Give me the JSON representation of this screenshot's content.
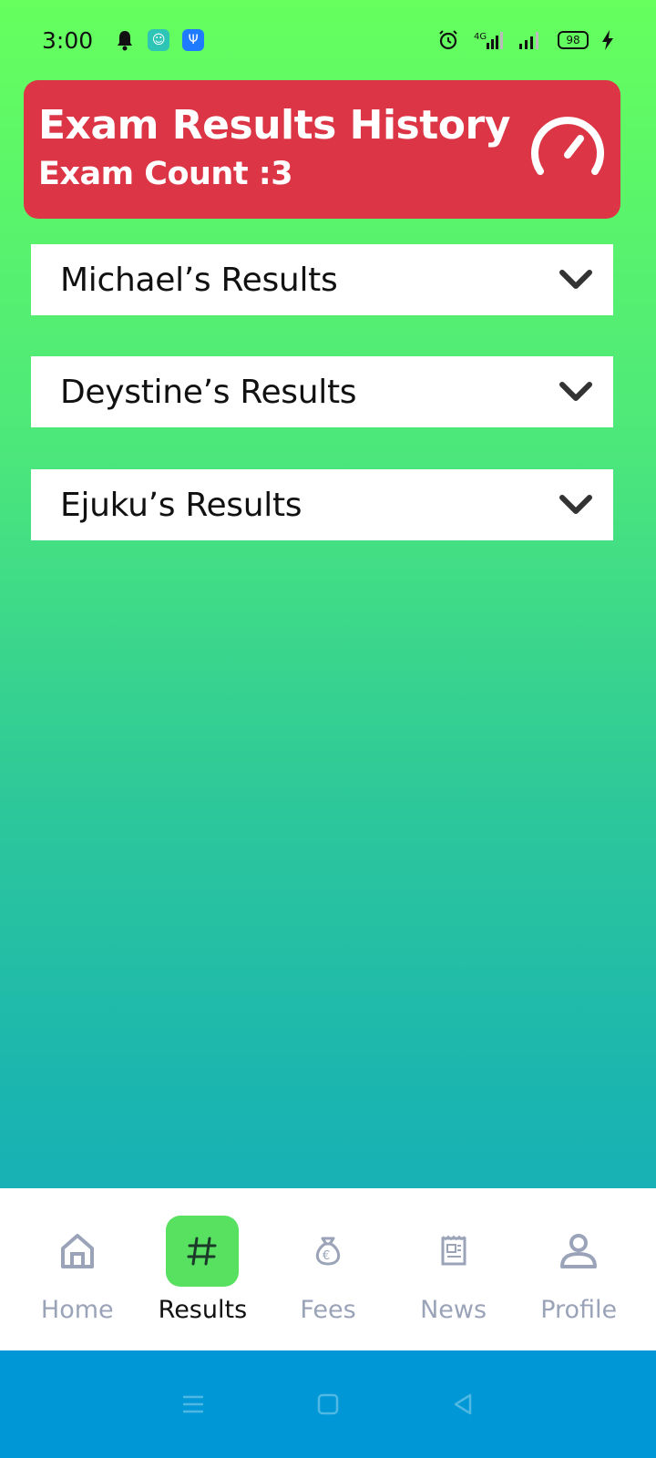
{
  "status_bar": {
    "time": "3:00",
    "battery": "98",
    "network": "4G",
    "icons": [
      "bell-icon",
      "app-chip-icon",
      "usb-icon",
      "alarm-icon",
      "signal-icon",
      "signal-icon",
      "battery-icon",
      "charging-icon"
    ]
  },
  "header": {
    "title": "Exam Results History",
    "count_label": "Exam Count :3",
    "icon": "speedometer-icon",
    "color": "#dc3545"
  },
  "results": {
    "items": [
      {
        "label": "Michael’s Results",
        "icon": "chevron-down-icon"
      },
      {
        "label": "Deystine’s Results",
        "icon": "chevron-down-icon"
      },
      {
        "label": "Ejuku’s Results",
        "icon": "chevron-down-icon"
      }
    ]
  },
  "bottom_nav": {
    "items": [
      {
        "label": "Home",
        "icon": "home-icon",
        "active": false
      },
      {
        "label": "Results",
        "icon": "hashtag-icon",
        "active": true
      },
      {
        "label": "Fees",
        "icon": "money-bag-icon",
        "active": false
      },
      {
        "label": "News",
        "icon": "newspaper-icon",
        "active": false
      },
      {
        "label": "Profile",
        "icon": "user-icon",
        "active": false
      }
    ],
    "active_color": "#58e060",
    "inactive_color": "#9aa3b8"
  },
  "system_nav": {
    "icons": [
      "menu-icon",
      "home-square-icon",
      "back-triangle-icon"
    ],
    "color": "#0097d6"
  }
}
